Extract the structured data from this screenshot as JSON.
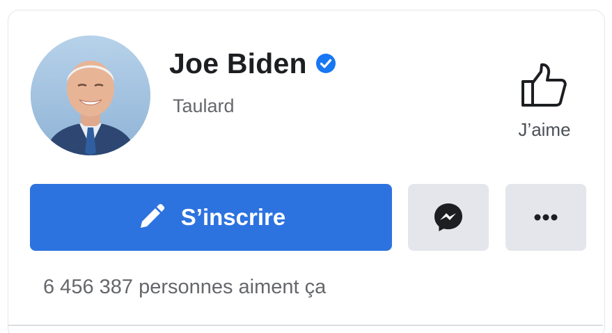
{
  "profile": {
    "name": "Joe Biden",
    "subtitle": "Taulard",
    "verified": true,
    "avatar_icon": "profile-photo"
  },
  "like": {
    "icon": "thumbs-up-icon",
    "label": "J’aime"
  },
  "actions": {
    "subscribe_label": "S’inscrire",
    "subscribe_icon": "pencil-icon",
    "message_icon": "messenger-icon",
    "more_icon": "more-icon"
  },
  "stats": {
    "likes_text": "6 456 387 personnes aiment ça"
  },
  "colors": {
    "primary_button": "#2d73e0",
    "verified_badge": "#1877f2",
    "secondary_button": "#e4e6eb",
    "text_primary": "#1c1e21",
    "text_secondary": "#65676b"
  }
}
